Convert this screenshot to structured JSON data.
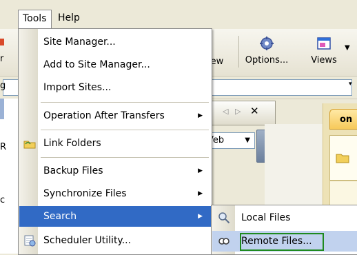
{
  "menubar": {
    "tools": "Tools",
    "help": "Help"
  },
  "toolbar": {
    "view": "iew",
    "options": "Options...",
    "views": "Views"
  },
  "left_partial": {
    "a": "r",
    "b": "g",
    "c": "R",
    "d": "c"
  },
  "panel": {
    "web_select": "Veb"
  },
  "right_panel": {
    "tab_label": "on"
  },
  "tools_menu": {
    "items": [
      {
        "label": "Site Manager...",
        "ul": "t"
      },
      {
        "label": "Add to Site Manager...",
        "ul": "A"
      },
      {
        "label": "Import Sites...",
        "ul": "t"
      },
      {
        "label": "Operation After Transfers",
        "ul": "p"
      },
      {
        "label": "Link Folders",
        "ul": "L"
      },
      {
        "label": "Backup Files",
        "ul": "u"
      },
      {
        "label": "Synchronize Files",
        "ul": "S"
      },
      {
        "label": "Search",
        "ul": "h"
      },
      {
        "label": "Scheduler Utility...",
        "ul": "c"
      }
    ]
  },
  "search_submenu": {
    "items": [
      {
        "label": "Local Files"
      },
      {
        "label": "Remote Files..."
      }
    ]
  },
  "colors": {
    "highlight": "#316ac5",
    "submenu_highlight": "#c1d2ee",
    "focus_border": "#1e8a1e"
  }
}
